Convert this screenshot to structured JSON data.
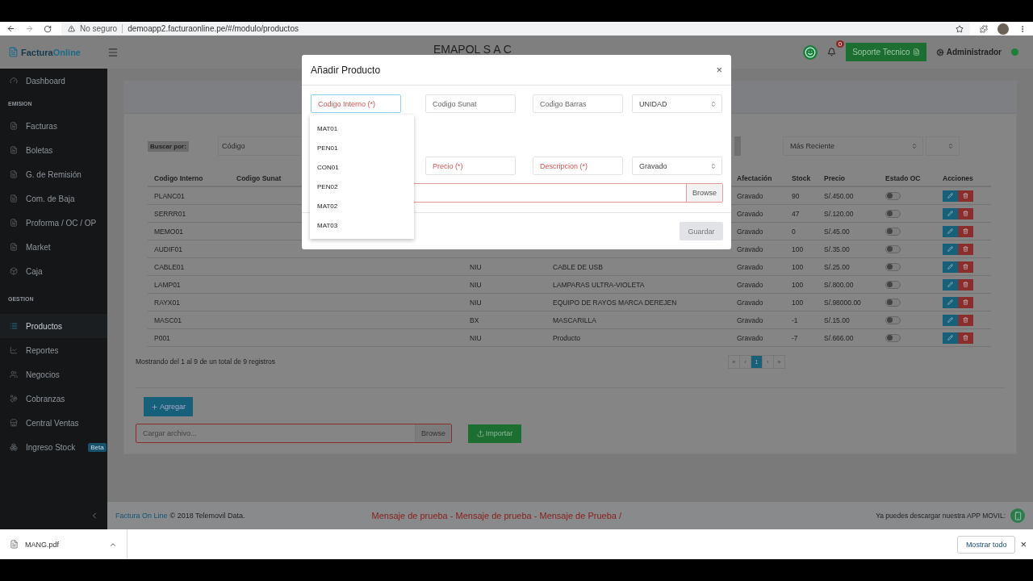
{
  "browser": {
    "security": "No seguro",
    "url": "demoapp2.facturaonline.pe/#/modulo/productos"
  },
  "header": {
    "logo_a": "Factura",
    "logo_b": "Online",
    "company": "EMAPOL S A C",
    "notifications": "0",
    "support": "Soporte Tecnico",
    "user": "Administrador",
    "user_online": true
  },
  "sidebar": {
    "items": [
      {
        "kind": "item",
        "label": "Dashboard",
        "selected": false
      },
      {
        "kind": "section",
        "label": "EMISION"
      },
      {
        "kind": "item",
        "label": "Facturas",
        "selected": false
      },
      {
        "kind": "item",
        "label": "Boletas",
        "selected": false
      },
      {
        "kind": "item",
        "label": "G. de Remisión",
        "selected": false
      },
      {
        "kind": "item",
        "label": "Com. de Baja",
        "selected": false
      },
      {
        "kind": "item",
        "label": "Proforma / OC / OP",
        "selected": false
      },
      {
        "kind": "item",
        "label": "Market",
        "selected": false
      },
      {
        "kind": "item",
        "label": "Caja",
        "selected": false
      },
      {
        "kind": "section",
        "label": "GESTION"
      },
      {
        "kind": "item",
        "label": "Productos",
        "selected": true
      },
      {
        "kind": "item",
        "label": "Reportes",
        "selected": false
      },
      {
        "kind": "item",
        "label": "Negocios",
        "selected": false
      },
      {
        "kind": "item",
        "label": "Cobranzas",
        "selected": false
      },
      {
        "kind": "item",
        "label": "Central Ventas",
        "selected": false
      },
      {
        "kind": "item",
        "label": "Ingreso Stock",
        "badge": "Beta",
        "selected": false
      }
    ]
  },
  "search": {
    "label": "Buscar por:",
    "placeholder": "Código",
    "sort": "Más Reciente"
  },
  "table": {
    "columns": [
      "Codigo Interno",
      "Codigo Sunat",
      "",
      "",
      "Afectación",
      "Stock",
      "Precio",
      "Estado OC",
      "Acciones"
    ],
    "rows": [
      {
        "codigo": "PLANC01",
        "afectacion": "Gravado",
        "stock": "90",
        "precio": "S/.450.00",
        "estado_oc": false
      },
      {
        "codigo": "SERRR01",
        "afectacion": "Gravado",
        "stock": "47",
        "precio": "S/.120.00",
        "estado_oc": false
      },
      {
        "codigo": "MEMO01",
        "afectacion": "Gravado",
        "stock": "0",
        "precio": "S/.45.00",
        "estado_oc": false
      },
      {
        "codigo": "AUDIF01",
        "afectacion": "Gravado",
        "stock": "100",
        "precio": "S/.35.00",
        "estado_oc": false
      },
      {
        "codigo": "CABLE01",
        "unidad": "NIU",
        "descripcion": "CABLE DE USB",
        "afectacion": "Gravado",
        "stock": "100",
        "precio": "S/.25.00",
        "estado_oc": false
      },
      {
        "codigo": "LAMP01",
        "unidad": "NIU",
        "descripcion": "LAMPARAS ULTRA-VIOLETA",
        "afectacion": "Gravado",
        "stock": "100",
        "precio": "S/.800.00",
        "estado_oc": false
      },
      {
        "codigo": "RAYX01",
        "unidad": "NIU",
        "descripcion": "EQUIPO DE RAYOS MARCA DEREJEN",
        "afectacion": "Gravado",
        "stock": "100",
        "precio": "S/.98000.00",
        "estado_oc": false
      },
      {
        "codigo": "MASC01",
        "unidad": "BX",
        "descripcion": "MASCARILLA",
        "afectacion": "Gravado",
        "stock": "-1",
        "precio": "S/.15.00",
        "estado_oc": false
      },
      {
        "codigo": "P001",
        "unidad": "NIU",
        "descripcion": "Producto",
        "afectacion": "Gravado",
        "stock": "-7",
        "precio": "S/.666.00",
        "estado_oc": false
      }
    ]
  },
  "summary": "Mostrando del 1 al 9 de un total de 9 registros",
  "pagination": [
    {
      "label": "«",
      "selected": false
    },
    {
      "label": "‹",
      "selected": false
    },
    {
      "label": "1",
      "selected": true
    },
    {
      "label": "›",
      "selected": false
    },
    {
      "label": "»",
      "selected": false
    }
  ],
  "add_button": "Agregar",
  "upload": {
    "placeholder": "Cargar archivo...",
    "browse": "Browse",
    "import": "Importar"
  },
  "footer": {
    "link": "Factura On Line",
    "copyright": "© 2018 Telemovil Data.",
    "message": "Mensaje de prueba - Mensaje de prueba - Mensaje de Prueba /",
    "app": "Ya puedes descargar nuestra APP MOVIL:"
  },
  "modal": {
    "title": "Añadir Producto",
    "close": "×",
    "row1": [
      {
        "kind": "input",
        "placeholder": "Codigo Interno (*)",
        "required": true,
        "focused": true
      },
      {
        "kind": "input",
        "placeholder": "Codigo Sunat",
        "required": false,
        "focused": false
      },
      {
        "kind": "input",
        "placeholder": "Codigo Barras",
        "required": false,
        "focused": false
      },
      {
        "kind": "select",
        "value": "UNIDAD"
      }
    ],
    "row2": [
      {
        "kind": "input",
        "placeholder": "Precio (*)",
        "required": true,
        "focused": false
      },
      {
        "kind": "input",
        "placeholder": "Descripcion (*)",
        "required": true,
        "focused": false
      },
      {
        "kind": "select",
        "value": "Gravado"
      }
    ],
    "file_browse": "Browse",
    "save": "Guardar",
    "save_disabled": true,
    "suggestions": [
      "MAT01",
      "PEN01",
      "CON01",
      "PEN02",
      "MAT02",
      "MAT03"
    ]
  },
  "downloads": {
    "file": "MANG.pdf",
    "show_all": "Mostrar todo",
    "close": "×"
  }
}
